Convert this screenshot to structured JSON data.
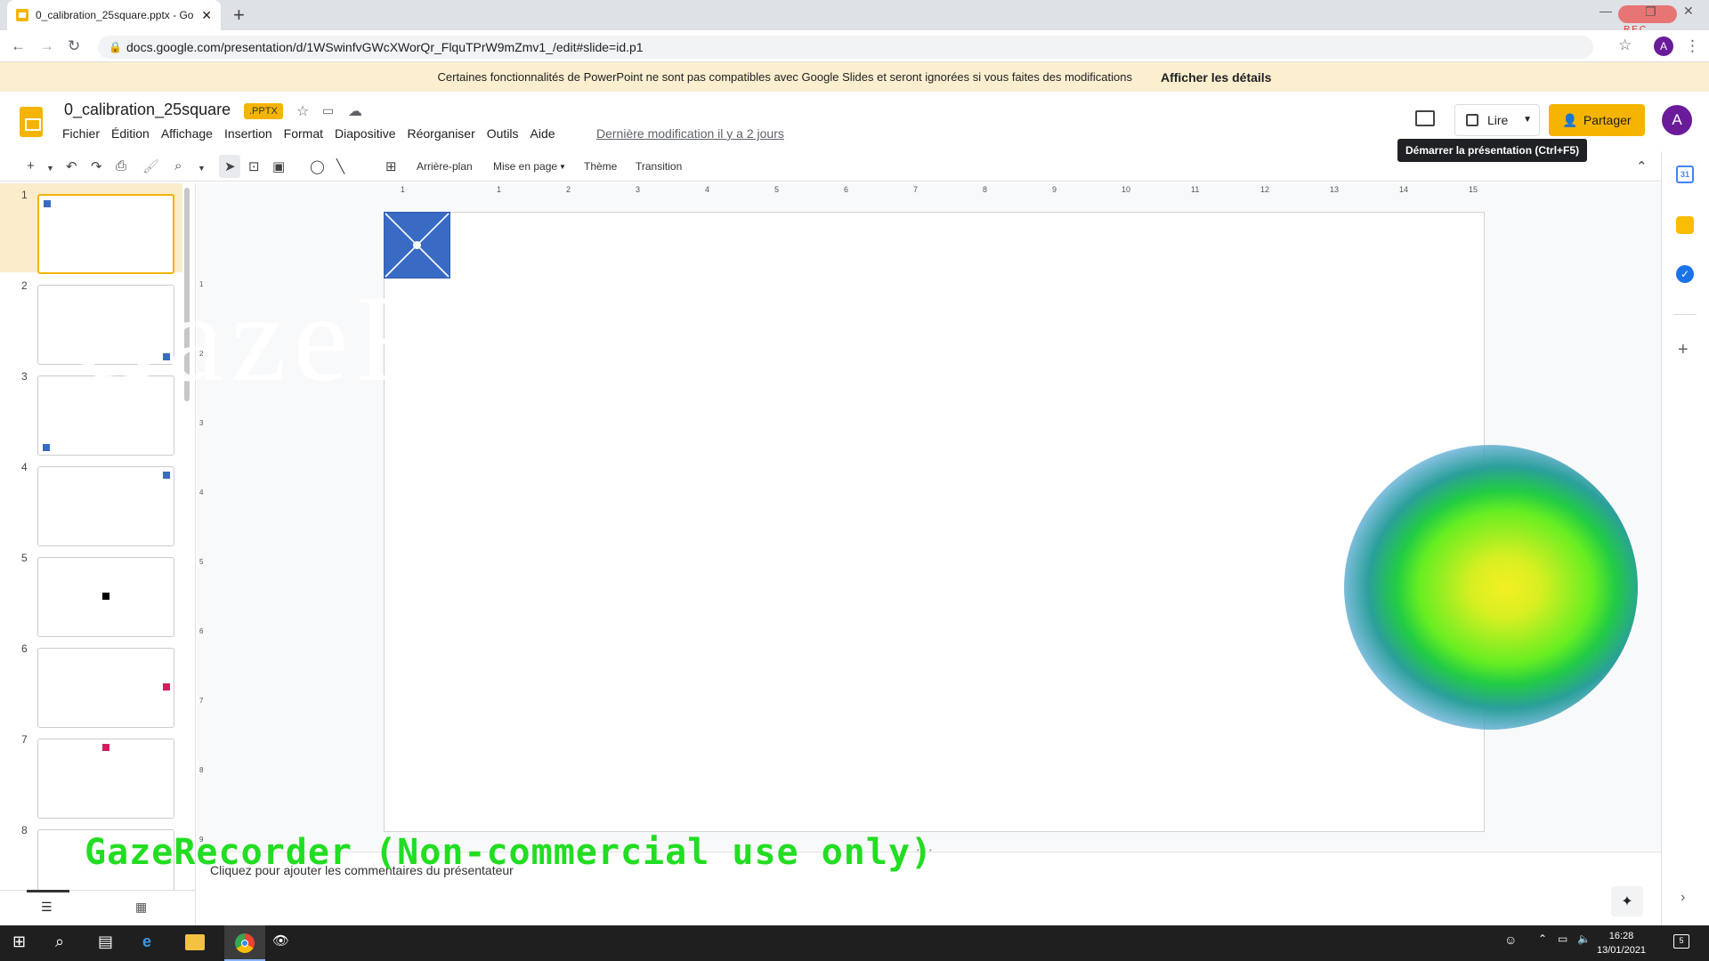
{
  "browser": {
    "tab_title": "0_calibration_25square.pptx - Go",
    "url": "docs.google.com/presentation/d/1WSwinfvGWcXWorQr_FlquTPrW9mZmv1_/edit#slide=id.p1",
    "rec_label": "REC",
    "profile_letter": "A"
  },
  "notice": {
    "message": "Certaines fonctionnalités de PowerPoint ne sont pas compatibles avec Google Slides et seront ignorées si vous faites des modifications",
    "details_label": "Afficher les détails"
  },
  "header": {
    "doc_title": "0_calibration_25square",
    "badge": ".PPTX",
    "menus": [
      "Fichier",
      "Édition",
      "Affichage",
      "Insertion",
      "Format",
      "Diapositive",
      "Réorganiser",
      "Outils",
      "Aide"
    ],
    "last_modified": "Dernière modification il y a 2 jours",
    "present_label": "Lire",
    "share_label": "Partager",
    "avatar_letter": "A",
    "tooltip": "Démarrer la présentation (Ctrl+F5)"
  },
  "toolbar": {
    "background_label": "Arrière-plan",
    "layout_label": "Mise en page",
    "theme_label": "Thème",
    "transition_label": "Transition"
  },
  "ruler": {
    "ticks": [
      "1",
      "1",
      "2",
      "3",
      "4",
      "5",
      "6",
      "7",
      "8",
      "9",
      "10",
      "11",
      "12",
      "13",
      "14",
      "15"
    ],
    "vticks": [
      "1",
      "2",
      "3",
      "4",
      "5",
      "6",
      "7",
      "8",
      "9"
    ]
  },
  "slides": [
    {
      "num": "1",
      "marker": "top-left",
      "color": "#3a6bc4"
    },
    {
      "num": "2",
      "marker": "bottom-right",
      "color": "#3a6bc4"
    },
    {
      "num": "3",
      "marker": "bottom-left",
      "color": "#3a6bc4"
    },
    {
      "num": "4",
      "marker": "top-right",
      "color": "#3a6bc4"
    },
    {
      "num": "5",
      "marker": "center",
      "color": "#000000"
    },
    {
      "num": "6",
      "marker": "right",
      "color": "#d81b60"
    },
    {
      "num": "7",
      "marker": "top-center",
      "color": "#d81b60"
    },
    {
      "num": "8",
      "marker": "none",
      "color": "#3a6bc4"
    }
  ],
  "canvas": {
    "watermark": "GazeRecorder",
    "overlay": "GazeRecorder (Non-commercial use only)",
    "notes_placeholder": "Cliquez pour ajouter les commentaires du présentateur",
    "target_color": "#3a6bc4"
  },
  "taskbar": {
    "time": "16:28",
    "date": "13/01/2021",
    "notification_count": "5"
  }
}
